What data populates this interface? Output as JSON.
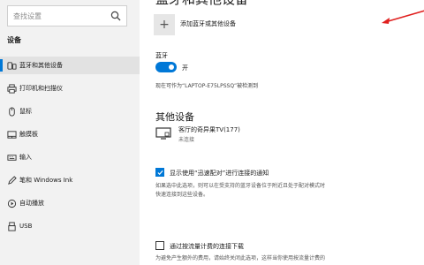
{
  "sidebar": {
    "search_placeholder": "查找设置",
    "heading": "设备",
    "items": [
      {
        "label": "蓝牙和其他设备",
        "icon": "bluetooth-devices-icon",
        "active": true
      },
      {
        "label": "打印机和扫描仪",
        "icon": "printer-icon",
        "active": false
      },
      {
        "label": "鼠标",
        "icon": "mouse-icon",
        "active": false
      },
      {
        "label": "触摸板",
        "icon": "touchpad-icon",
        "active": false
      },
      {
        "label": "输入",
        "icon": "keyboard-icon",
        "active": false
      },
      {
        "label": "笔和 Windows Ink",
        "icon": "pen-icon",
        "active": false
      },
      {
        "label": "自动播放",
        "icon": "autoplay-icon",
        "active": false
      },
      {
        "label": "USB",
        "icon": "usb-icon",
        "active": false
      }
    ]
  },
  "main": {
    "page_title": "蓝牙和其他设备",
    "add_device_label": "添加蓝牙或其他设备",
    "bluetooth": {
      "label": "蓝牙",
      "state": "开",
      "discoverable_text": "现在可作为“LAPTOP-E75LPSSQ”被检测到"
    },
    "other_devices": {
      "title": "其他设备",
      "devices": [
        {
          "name": "客厅的奇异果TV(177)",
          "status": "未连接"
        }
      ]
    },
    "swift_pair": {
      "label": "显示使用“迅速配对”进行连接的通知",
      "checked": true,
      "description_line1": "如果选中此选项，则可以在受支持的蓝牙设备位于附近且处于配对模式时",
      "description_line2": "快速连接到这些设备。"
    },
    "metered": {
      "label": "通过按流量计费的连接下载",
      "checked": false,
      "description_line1": "为避免产生额外的费用，请始终关闭此选项，这样当你使用按流量计费的"
    }
  },
  "colors": {
    "accent": "#0078d7",
    "annotation_arrow": "#e0201f",
    "sidebar_bg": "#f2f2f2"
  }
}
